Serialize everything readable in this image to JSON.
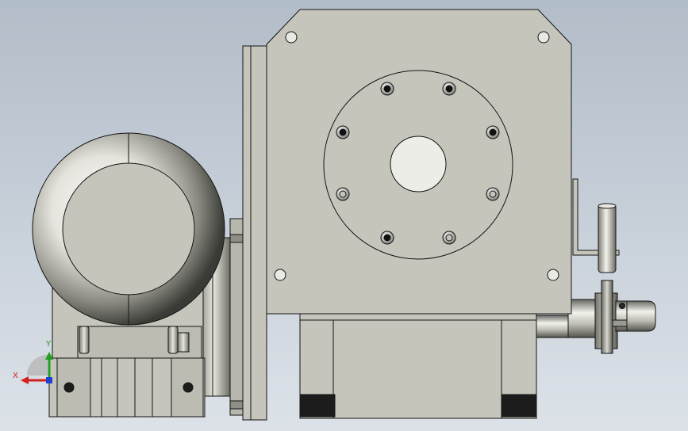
{
  "viewport": {
    "background_top": "#B2BDC9",
    "background_bottom": "#DCE2E8",
    "body_color": "#C6C5BC",
    "edge_color": "#141414"
  },
  "triad": {
    "x_label": "X",
    "y_label": "Y",
    "x_color": "#D02020",
    "y_color": "#20A020",
    "z_color": "#2040D0"
  }
}
